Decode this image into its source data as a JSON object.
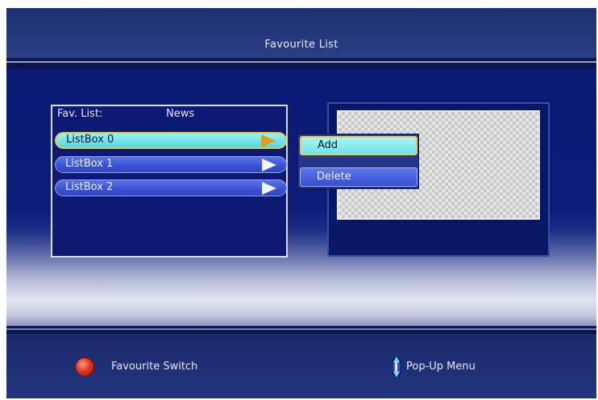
{
  "header": {
    "title": "Favourite List"
  },
  "fav_panel": {
    "label": "Fav. List:",
    "value": "News",
    "items": [
      {
        "label": "ListBox 0",
        "selected": true
      },
      {
        "label": "ListBox 1",
        "selected": false
      },
      {
        "label": "ListBox 2",
        "selected": false
      }
    ]
  },
  "popup_menu": {
    "items": [
      {
        "label": "Add",
        "highlighted": true
      },
      {
        "label": "Delete",
        "highlighted": false
      }
    ]
  },
  "footer": {
    "red_button": {
      "icon": "red-circle-icon",
      "label": "Favourite Switch"
    },
    "updown_button": {
      "icon": "up-down-arrow-icon",
      "label": "Pop-Up Menu"
    }
  },
  "colors": {
    "background": "#182560",
    "selection_fill": "#6fe3e6",
    "selection_border": "#e9c94a",
    "row_fill": "#3b54d4",
    "selected_arrow": "#e49c18"
  }
}
